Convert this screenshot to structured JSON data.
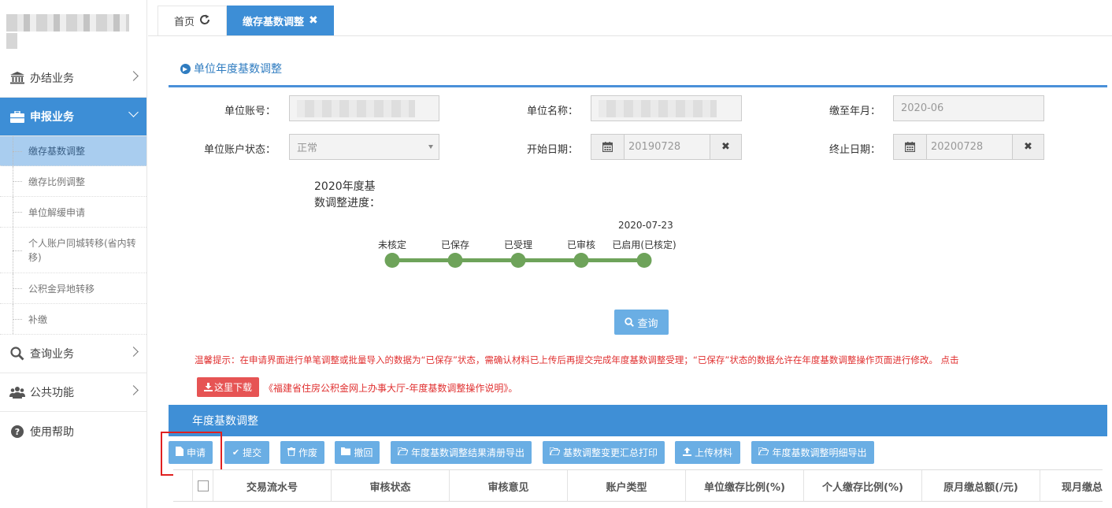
{
  "sidebar": {
    "menu": [
      {
        "label": "办结业务",
        "icon": "bank-icon"
      },
      {
        "label": "申报业务",
        "icon": "briefcase-icon"
      },
      {
        "label": "查询业务",
        "icon": "search-icon"
      },
      {
        "label": "公共功能",
        "icon": "users-icon"
      },
      {
        "label": "使用帮助",
        "icon": "help-icon"
      }
    ],
    "submenu": [
      "缴存基数调整",
      "缴存比例调整",
      "单位解缓申请",
      "个人账户同城转移(省内转移)",
      "公积金异地转移",
      "补缴"
    ]
  },
  "tabs": [
    {
      "label": "首页"
    },
    {
      "label": "缴存基数调整"
    }
  ],
  "section": {
    "title": "单位年度基数调整"
  },
  "form": {
    "account_no_label": "单位账号：",
    "unit_name_label": "单位名称：",
    "paid_until_label": "缴至年月：",
    "paid_until_value": "2020-06",
    "status_label": "单位账户状态：",
    "status_value": "正常",
    "start_date_label": "开始日期：",
    "start_date_value": "20190728",
    "end_date_label": "终止日期：",
    "end_date_value": "20200728"
  },
  "progress": {
    "label": "2020年度基数调整进度：",
    "date": "2020-07-23",
    "steps": [
      "未核定",
      "已保存",
      "已受理",
      "已审核",
      "已启用(已核定)"
    ]
  },
  "query_button": "查询",
  "tip": "温馨提示：在申请界面进行单笔调整或批量导入的数据为“已保存”状态，需确认材料已上传后再提交完成年度基数调整受理；“已保存”状态的数据允许在年度基数调整操作页面进行修改。 点击",
  "download_button": "这里下载",
  "doc_link": "《福建省住房公积金网上办事大厅-年度基数调整操作说明》。",
  "panel_title": "年度基数调整",
  "toolbar": [
    {
      "label": "申请"
    },
    {
      "label": "提交"
    },
    {
      "label": "作废"
    },
    {
      "label": "撤回"
    },
    {
      "label": "年度基数调整结果清册导出"
    },
    {
      "label": "基数调整变更汇总打印"
    },
    {
      "label": "上传材料"
    },
    {
      "label": "年度基数调整明细导出"
    }
  ],
  "table": {
    "columns": [
      "交易流水号",
      "审核状态",
      "审核意见",
      "账户类型",
      "单位缴存比例(%)",
      "个人缴存比例(%)",
      "原月缴总额(/元)",
      "现月缴总"
    ]
  },
  "colors": {
    "accent": "#3d8ed6",
    "button": "#6aaee4",
    "progress": "#6ea35a",
    "warning": "#e03030"
  }
}
